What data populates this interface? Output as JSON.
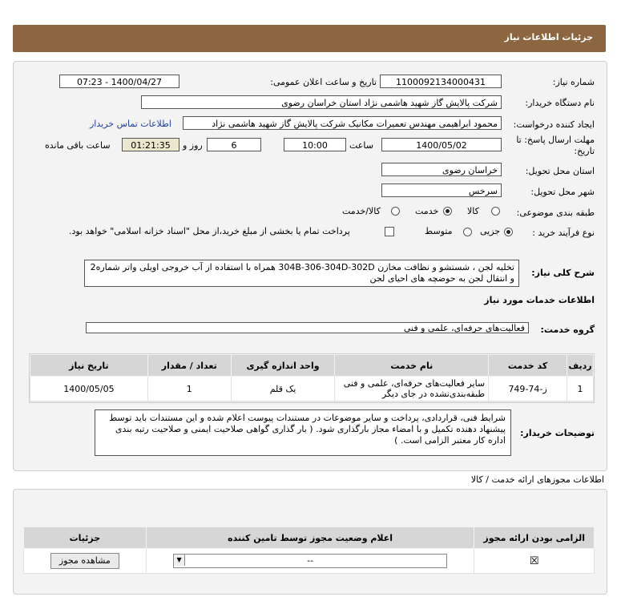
{
  "header": {
    "title": "جزئیات اطلاعات نیاز"
  },
  "form": {
    "need_number_label": "شماره نیاز:",
    "need_number": "1100092134000431",
    "announce_label": "تاریخ و ساعت اعلان عمومی:",
    "announce_value": "1400/04/27 - 07:23",
    "buyer_org_label": "نام دستگاه خریدار:",
    "buyer_org": "شرکت پالایش گاز شهید هاشمی نژاد   استان خراسان رضوی",
    "creator_label": "ایجاد کننده درخواست:",
    "creator": "محمود ابراهیمی مهندس تعمیرات مکانیک شرکت پالایش گاز شهید هاشمی نژاد",
    "contact_link": "اطلاعات تماس خریدار",
    "deadline_label_1": "مهلت ارسال پاسخ: تا",
    "deadline_label_2": "تاریخ:",
    "deadline_date": "1400/05/02",
    "time_label": "ساعت",
    "deadline_time": "10:00",
    "days_value": "6",
    "days_label": "روز و",
    "remaining_time": "01:21:35",
    "remaining_label": "ساعت باقی مانده",
    "delivery_province_label": "استان محل تحویل:",
    "delivery_province": "خراسان رضوی",
    "delivery_city_label": "شهر محل تحویل:",
    "delivery_city": "سرخس",
    "category_label": "طبقه بندی موضوعی:",
    "category_options": [
      "کالا",
      "خدمت",
      "کالا/خدمت"
    ],
    "purchase_type_label": "نوع فرآیند خرید :",
    "purchase_options": [
      "جزیی",
      "متوسط"
    ],
    "payment_text": "پرداخت تمام یا بخشی از مبلغ خرید،از محل \"اسناد خزانه اسلامی\" خواهد بود."
  },
  "description": {
    "label": "شرح کلی نیاز:",
    "text": "تخلیه لجن ، شستشو و نظافت مخازن 304B-306-304D-302D همراه با استفاده از آب خروجی اویلی واتر شماره2 و انتقال لجن به حوضچه های احیای لجن"
  },
  "services_section": {
    "title": "اطلاعات خدمات مورد نیاز",
    "group_label": "گروه خدمت:",
    "group_value": "فعالیت‌های حرفه‌ای، علمی و فنی"
  },
  "service_table": {
    "headers": [
      "ردیف",
      "کد خدمت",
      "نام خدمت",
      "واحد اندازه گیری",
      "تعداد / مقدار",
      "تاریخ نیاز"
    ],
    "rows": [
      [
        "1",
        "ز-74-749",
        "سایر فعالیت‌های حرفه‌ای، علمی و فنی طبقه‌بندی‌نشده در جای دیگر",
        "یک قلم",
        "1",
        "1400/05/05"
      ]
    ]
  },
  "buyer_notes": {
    "label": "توضیحات خریدار:",
    "text": "شرایط فنی، قراردادی، پرداخت و سایر موضوعات در مستندات پیوست اعلام شده و این مستندات باید توسط پیشنهاد دهنده تکمیل و با امضاء مجاز بارگذاری شود. ( بار گذاری گواهی صلاحیت ایمنی و صلاحیت رتبه بندی اداره کار معتبر الزامی است. )"
  },
  "permits": {
    "title": "اطلاعات مجوزهای ارائه خدمت / کالا",
    "headers": [
      "الزامی بودن ارائه مجوز",
      "اعلام وضعیت مجوز توسط تامین کننده",
      "جزئیات"
    ],
    "select_value": "--",
    "view_button": "مشاهده مجوز"
  }
}
